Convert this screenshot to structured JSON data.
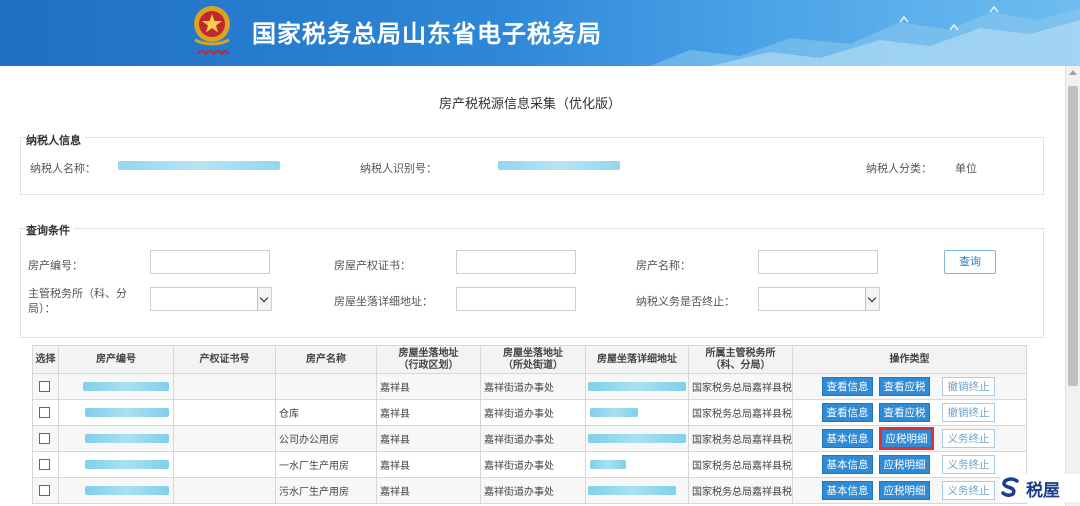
{
  "header": {
    "title": "国家税务总局山东省电子税务局"
  },
  "page": {
    "title": "房产税税源信息采集（优化版）"
  },
  "taxpayer": {
    "section_label": "纳税人信息",
    "name_label": "纳税人名称：",
    "id_label": "纳税人识别号：",
    "category_label": "纳税人分类：",
    "category_value": "单位"
  },
  "query": {
    "section_label": "查询条件",
    "property_no_label": "房产编号：",
    "cert_label": "房屋产权证书：",
    "property_name_label": "房产名称：",
    "tax_office_label_1": "主管税务所（科、分",
    "tax_office_label_2": "局）：",
    "address_label": "房屋坐落详细地址：",
    "terminated_label": "纳税义务是否终止：",
    "search_button": "查询"
  },
  "table": {
    "headers": {
      "select": "选择",
      "property_no": "房产编号",
      "cert_no": "产权证书号",
      "name": "房产名称",
      "district_1": "房屋坐落地址",
      "district_2": "（行政区划）",
      "street_1": "房屋坐落地址",
      "street_2": "（所处街道）",
      "address": "房屋坐落详细地址",
      "office_1": "所属主管税务所",
      "office_2": "（科、分局）",
      "ops": "操作类型"
    },
    "rows": [
      {
        "name": "",
        "district": "嘉祥县",
        "street": "嘉祥街道办事处",
        "office": "国家税务总局嘉祥县税务",
        "btn1": "查看信息",
        "btn2": "查看应税",
        "btn3": "撤销终止"
      },
      {
        "name": "仓库",
        "district": "嘉祥县",
        "street": "嘉祥街道办事处",
        "office": "国家税务总局嘉祥县税务",
        "btn1": "查看信息",
        "btn2": "查看应税",
        "btn3": "撤销终止"
      },
      {
        "name": "公司办公用房",
        "district": "嘉祥县",
        "street": "嘉祥街道办事处",
        "office": "国家税务总局嘉祥县税务",
        "btn1": "基本信息",
        "btn2": "应税明细",
        "btn3": "义务终止"
      },
      {
        "name": "一水厂生产用房",
        "district": "嘉祥县",
        "street": "嘉祥街道办事处",
        "office": "国家税务总局嘉祥县税务",
        "btn1": "基本信息",
        "btn2": "应税明细",
        "btn3": "义务终止"
      },
      {
        "name": "污水厂生产用房",
        "district": "嘉祥县",
        "street": "嘉祥街道办事处",
        "office": "国家税务总局嘉祥县税务",
        "btn1": "基本信息",
        "btn2": "应税明细",
        "btn3": "义务终止"
      }
    ]
  },
  "watermark": {
    "text": "税屋"
  },
  "colors": {
    "banner": "#2d86d6",
    "button_blue": "#2f8bd6",
    "highlight": "#e03030"
  }
}
